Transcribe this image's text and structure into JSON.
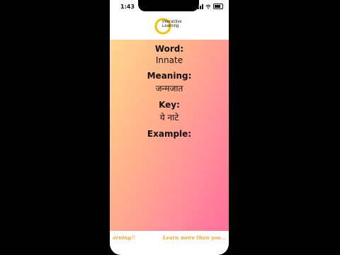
{
  "status": {
    "time": "1:43"
  },
  "header": {
    "logo_line1": "Interactive",
    "logo_line2": "Learning"
  },
  "card": {
    "word_label": "Word:",
    "word_value": "Innate",
    "meaning_label": "Meaning:",
    "meaning_value": "जन्मजात",
    "key_label": "Key:",
    "key_value": "ये नाटे",
    "example_label": "Example:"
  },
  "footer": {
    "left_text": "arning!!",
    "right_text": "Learn more than you..."
  },
  "colors": {
    "accent": "#f2a430",
    "gradient_start": "#ffd790",
    "gradient_end": "#ff6f9a"
  },
  "icons": [
    "signal-icon",
    "wifi-icon",
    "battery-icon",
    "logo-icon"
  ]
}
